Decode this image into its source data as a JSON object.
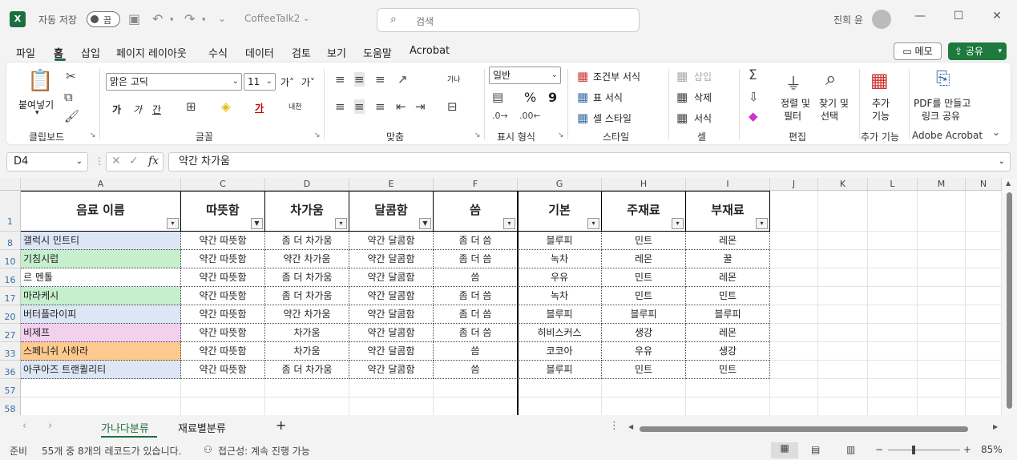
{
  "app": {
    "logo_text": "X",
    "autosave_label": "자동 저장",
    "autosave_state": "끔",
    "doc_title": "CoffeeTalk2",
    "search_placeholder": "검색",
    "user_name": "진희 윤"
  },
  "menu": {
    "tabs": [
      "파일",
      "홈",
      "삽입",
      "페이지 레이아웃",
      "수식",
      "데이터",
      "검토",
      "보기",
      "도움말",
      "Acrobat"
    ],
    "memo_label": "메모",
    "share_label": "공유"
  },
  "ribbon": {
    "clipboard": {
      "paste": "붙여넣기",
      "label": "클립보드"
    },
    "font": {
      "name": "맑은 고딕",
      "size": "11",
      "grow": "가˄",
      "shrink": "가˅",
      "bold": "가",
      "italic": "가",
      "underline": "간",
      "phonetic": "내천",
      "label": "글꼴"
    },
    "alignment": {
      "label": "맞춤",
      "wrap": "가나"
    },
    "number": {
      "format": "일반",
      "percent": "%",
      "comma": "9",
      "label": "표시 형식"
    },
    "styles": {
      "conditional": "조건부 서식",
      "table": "표 서식",
      "cell": "셀 스타일",
      "label": "스타일"
    },
    "cells": {
      "insert": "삽입",
      "delete": "삭제",
      "format": "서식",
      "label": "셀"
    },
    "editing": {
      "sort": "정렬 및",
      "sort2": "필터",
      "find": "찾기 및",
      "find2": "선택",
      "label": "편집"
    },
    "addins": {
      "btn": "추가",
      "btn2": "기능",
      "label": "추가 기능"
    },
    "acrobat": {
      "btn": "PDF를 만들고",
      "btn2": "링크 공유",
      "label": "Adobe Acrobat"
    }
  },
  "formula_bar": {
    "name_box": "D4",
    "fx": "fx",
    "value": "약간 차가움"
  },
  "sheet": {
    "columns": [
      "A",
      "C",
      "D",
      "E",
      "F",
      "G",
      "H",
      "I",
      "J",
      "K",
      "L",
      "M",
      "N"
    ],
    "headers": [
      "음료 이름",
      "따뜻함",
      "차가움",
      "달콤함",
      "씀",
      "기본",
      "주재료",
      "부재료"
    ],
    "header_row_num": "1",
    "rows": [
      {
        "num": "8",
        "name": "갤럭시 민트티",
        "color": "#dce6f5",
        "cells": [
          "약간 따뜻함",
          "좀 더 차가움",
          "약간 달콤함",
          "좀 더 씀",
          "블루피",
          "민트",
          "레몬"
        ]
      },
      {
        "num": "10",
        "name": "기침시럽",
        "color": "#c6efce",
        "cells": [
          "약간 따뜻함",
          "약간 차가움",
          "약간 달콤함",
          "좀 더 씀",
          "녹차",
          "레몬",
          "꿀"
        ]
      },
      {
        "num": "16",
        "name": "르 멘톨",
        "color": "#ffffff",
        "cells": [
          "약간 따뜻함",
          "좀 더 차가움",
          "약간 달콤함",
          "씀",
          "우유",
          "민트",
          "레몬"
        ]
      },
      {
        "num": "17",
        "name": "마라케시",
        "color": "#c6efce",
        "cells": [
          "약간 따뜻함",
          "좀 더 차가움",
          "약간 달콤함",
          "좀 더 씀",
          "녹차",
          "민트",
          "민트"
        ]
      },
      {
        "num": "20",
        "name": "버터플라이피",
        "color": "#dce6f5",
        "cells": [
          "약간 따뜻함",
          "약간 차가움",
          "약간 달콤함",
          "좀 더 씀",
          "블루피",
          "블루피",
          "블루피"
        ]
      },
      {
        "num": "27",
        "name": "비제프",
        "color": "#f2d0ee",
        "cells": [
          "약간 따뜻함",
          "차가움",
          "약간 달콤함",
          "좀 더 씀",
          "히비스커스",
          "생강",
          "레몬"
        ]
      },
      {
        "num": "33",
        "name": "스페니쉬 사하라",
        "color": "#fdc98e",
        "cells": [
          "약간 따뜻함",
          "차가움",
          "약간 달콤함",
          "씀",
          "코코아",
          "우유",
          "생강"
        ]
      },
      {
        "num": "36",
        "name": "아쿠아즈 트랜퀼리티",
        "color": "#dce6f5",
        "cells": [
          "약간 따뜻함",
          "좀 더 차가움",
          "약간 달콤함",
          "씀",
          "블루피",
          "민트",
          "민트"
        ]
      }
    ],
    "empty_rows": [
      "57",
      "58"
    ]
  },
  "sheet_tabs": {
    "tabs": [
      "가나다분류",
      "재료별분류"
    ],
    "add": "+"
  },
  "status": {
    "ready": "준비",
    "records": "55개 중 8개의 레코드가 있습니다.",
    "accessibility": "접근성: 계속 진행 가능",
    "zoom": "85%"
  }
}
